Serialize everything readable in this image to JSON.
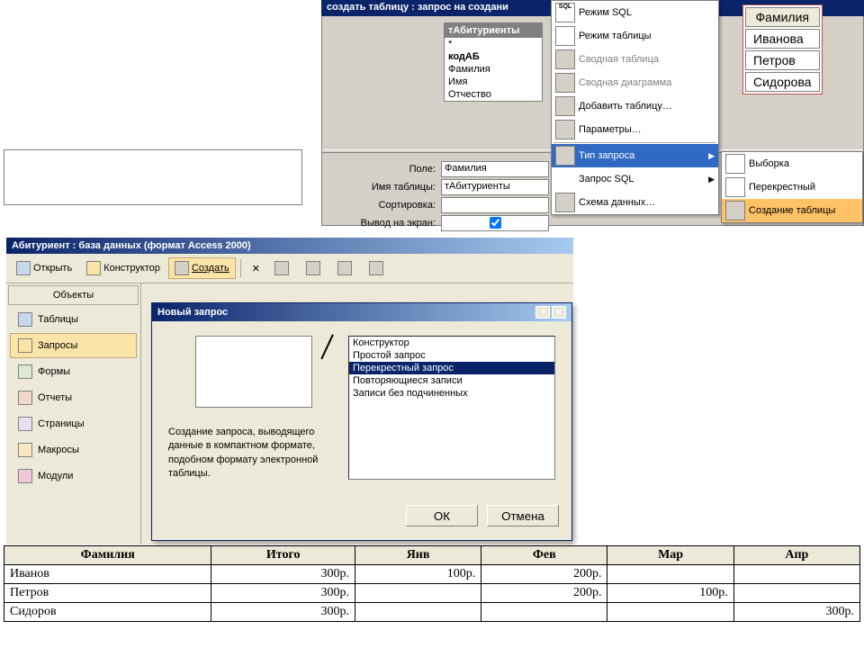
{
  "query_designer": {
    "title": "создать таблицу : запрос на создани",
    "field_list_header": "тАбитуриенты",
    "field_list": [
      "*",
      "кодАБ",
      "Фамилия",
      "Имя",
      "Отчество"
    ],
    "grid": {
      "labels": {
        "field": "Поле:",
        "table": "Имя таблицы:",
        "sort": "Сортировка:",
        "output": "Вывод на экран:"
      },
      "values": {
        "field": "Фамилия",
        "table": "тАбитуриенты",
        "sort": "",
        "output": true
      }
    }
  },
  "ctx_menu": [
    {
      "icon": "SQL",
      "label": "Режим SQL",
      "disabled": false
    },
    {
      "icon": "grid",
      "label": "Режим таблицы",
      "disabled": false,
      "underline": 6
    },
    {
      "icon": "pivot",
      "label": "Сводная таблица",
      "disabled": true
    },
    {
      "icon": "chart",
      "label": "Сводная диаграмма",
      "disabled": true
    },
    {
      "icon": "add",
      "label": "Добавить таблицу…",
      "disabled": false
    },
    {
      "icon": "param",
      "label": "Параметры…",
      "disabled": false
    },
    {
      "sep": true
    },
    {
      "icon": "type",
      "label": "Тип запроса",
      "disabled": false,
      "highlighted": true,
      "submenu": true
    },
    {
      "icon": "sqlq",
      "label": "Запрос SQL",
      "disabled": false,
      "submenu": true
    },
    {
      "icon": "schema",
      "label": "Схема данных…",
      "disabled": false
    }
  ],
  "sub_menu": [
    {
      "icon": "select",
      "label": "Выборка"
    },
    {
      "icon": "cross",
      "label": "Перекрестный"
    },
    {
      "icon": "make",
      "label": "Создание таблицы",
      "highlighted": true
    }
  ],
  "result_preview": {
    "header": "Фамилия",
    "rows": [
      "Иванова",
      "Петров",
      "Сидорова"
    ]
  },
  "db_window": {
    "title": "Абитуриент : база данных (формат Access 2000)",
    "toolbar": {
      "open": "Открыть",
      "design": "Конструктор",
      "create": "Создать"
    },
    "sidebar_header": "Объекты",
    "sidebar": [
      {
        "icon": "table",
        "label": "Таблицы"
      },
      {
        "icon": "query",
        "label": "Запросы",
        "active": true
      },
      {
        "icon": "form",
        "label": "Формы"
      },
      {
        "icon": "report",
        "label": "Отчеты"
      },
      {
        "icon": "page",
        "label": "Страницы"
      },
      {
        "icon": "macro",
        "label": "Макросы"
      },
      {
        "icon": "module",
        "label": "Модули"
      }
    ]
  },
  "dialog": {
    "title": "Новый запрос",
    "description": "Создание запроса, выводящего данные в компактном формате, подобном формату электронной таблицы.",
    "list": [
      "Конструктор",
      "Простой запрос",
      "Перекрестный запрос",
      "Повторяющиеся записи",
      "Записи без подчиненных"
    ],
    "selected_index": 2,
    "ok": "ОК",
    "cancel": "Отмена"
  },
  "chart_data": {
    "type": "table",
    "title": "Crosstab query result",
    "columns": [
      "Фамилия",
      "Итого",
      "Янв",
      "Фев",
      "Мар",
      "Апр"
    ],
    "rows": [
      {
        "Фамилия": "Иванов",
        "Итого": "300р.",
        "Янв": "100р.",
        "Фев": "200р.",
        "Мар": "",
        "Апр": ""
      },
      {
        "Фамилия": "Петров",
        "Итого": "300р.",
        "Янв": "",
        "Фев": "200р.",
        "Мар": "100р.",
        "Апр": ""
      },
      {
        "Фамилия": "Сидоров",
        "Итого": "300р.",
        "Янв": "",
        "Фев": "",
        "Мар": "",
        "Апр": "300р."
      }
    ]
  }
}
